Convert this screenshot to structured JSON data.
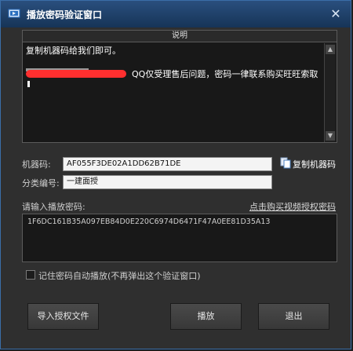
{
  "window": {
    "title": "播放密码验证窗口",
    "close_glyph": "✕"
  },
  "notice_panel": {
    "header": "说明",
    "line1": "复制机器码给我们即可。",
    "line2": "QQ仅受理售后问题，密码一律联系购买旺旺索取",
    "scroll_up": "▲",
    "scroll_down": "▼"
  },
  "machine_code": {
    "label": "机器码:",
    "value": "AF055F3DE02A1DD62B71DE",
    "copy_label": "复制机器码"
  },
  "category": {
    "label": "分类编号:",
    "value": "一建面授"
  },
  "password": {
    "label": "请输入播放密码:",
    "buy_link": "点击购买视频授权密码",
    "value": "1F6DC161B35A097EB84D0E220C6974D6471F47A0EE81D35A13"
  },
  "remember": {
    "label": "记住密码自动播放(不再弹出这个验证窗口)",
    "checked": false
  },
  "buttons": {
    "import": "导入授权文件",
    "play": "播放",
    "exit": "退出"
  },
  "colors": {
    "titlebar": "#1f4572",
    "accent": "#3a6ea8",
    "redaction": "#ff2f2f"
  },
  "icons": {
    "app": "app-film-icon",
    "copy": "copy-document-icon",
    "close": "close-icon"
  }
}
